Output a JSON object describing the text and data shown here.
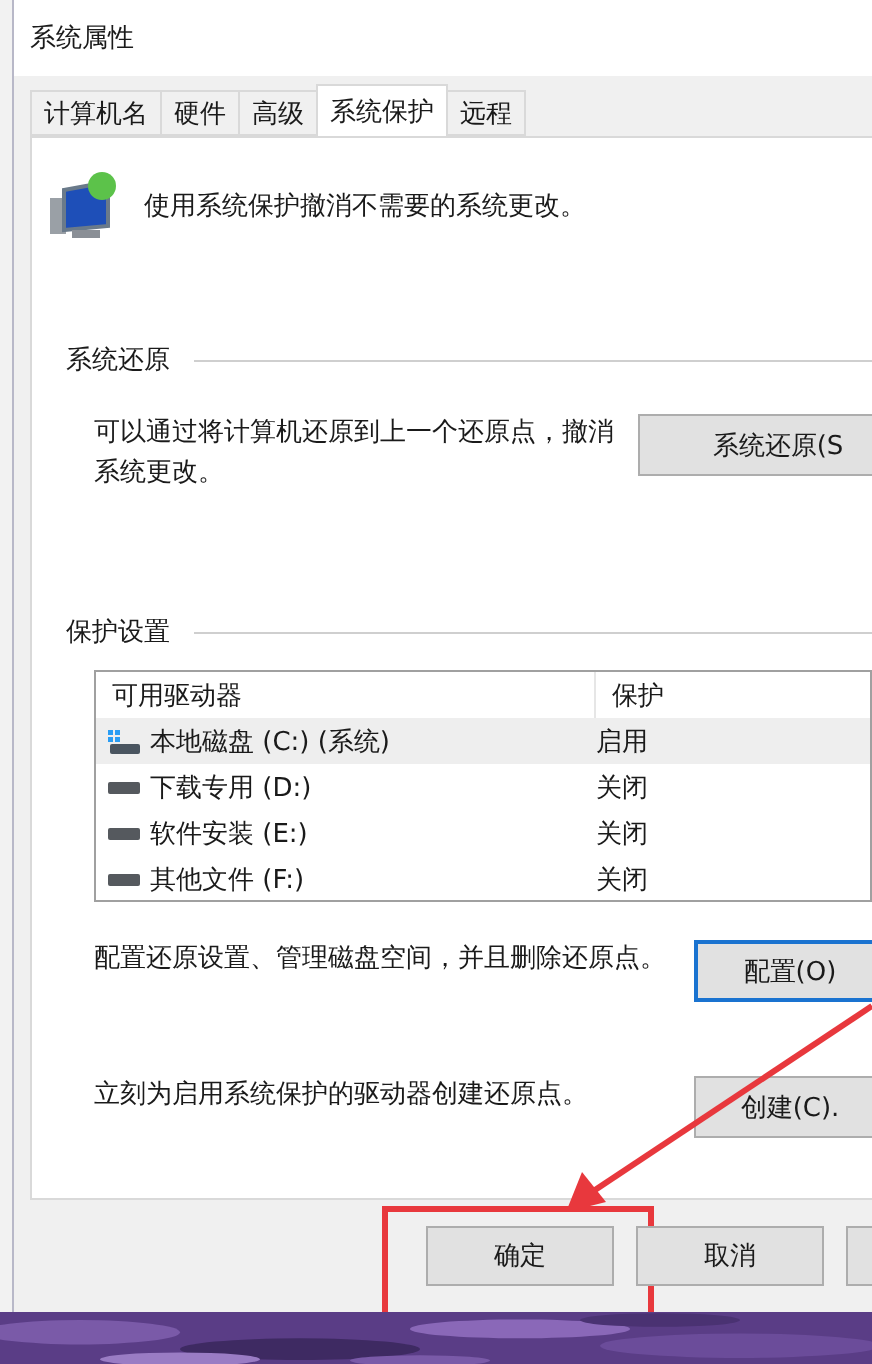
{
  "window": {
    "title": "系统属性"
  },
  "tabs": [
    {
      "label": "计算机名",
      "selected": false
    },
    {
      "label": "硬件",
      "selected": false
    },
    {
      "label": "高级",
      "selected": false
    },
    {
      "label": "系统保护",
      "selected": true
    },
    {
      "label": "远程",
      "selected": false
    }
  ],
  "description": "使用系统保护撤消不需要的系统更改。",
  "restore": {
    "heading": "系统还原",
    "text": "可以通过将计算机还原到上一个还原点，撤消系统更改。",
    "button": "系统还原(S"
  },
  "protection": {
    "heading": "保护设置",
    "columns": [
      "可用驱动器",
      "保护"
    ],
    "drives": [
      {
        "name": "本地磁盘 (C:) (系统)",
        "protection": "启用",
        "kind": "system",
        "selected": true
      },
      {
        "name": "下载专用 (D:)",
        "protection": "关闭",
        "kind": "drive",
        "selected": false
      },
      {
        "name": "软件安装 (E:)",
        "protection": "关闭",
        "kind": "drive",
        "selected": false
      },
      {
        "name": "其他文件 (F:)",
        "protection": "关闭",
        "kind": "drive",
        "selected": false
      }
    ],
    "configure": {
      "text": "配置还原设置、管理磁盘空间，并且删除还原点。",
      "button": "配置(O)",
      "focused": true
    },
    "create": {
      "text": "立刻为启用系统保护的驱动器创建还原点。",
      "button": "创建(C).",
      "focused": false
    }
  },
  "buttons": [
    {
      "label": "确定",
      "highlighted": true
    },
    {
      "label": "取消",
      "highlighted": false
    }
  ]
}
